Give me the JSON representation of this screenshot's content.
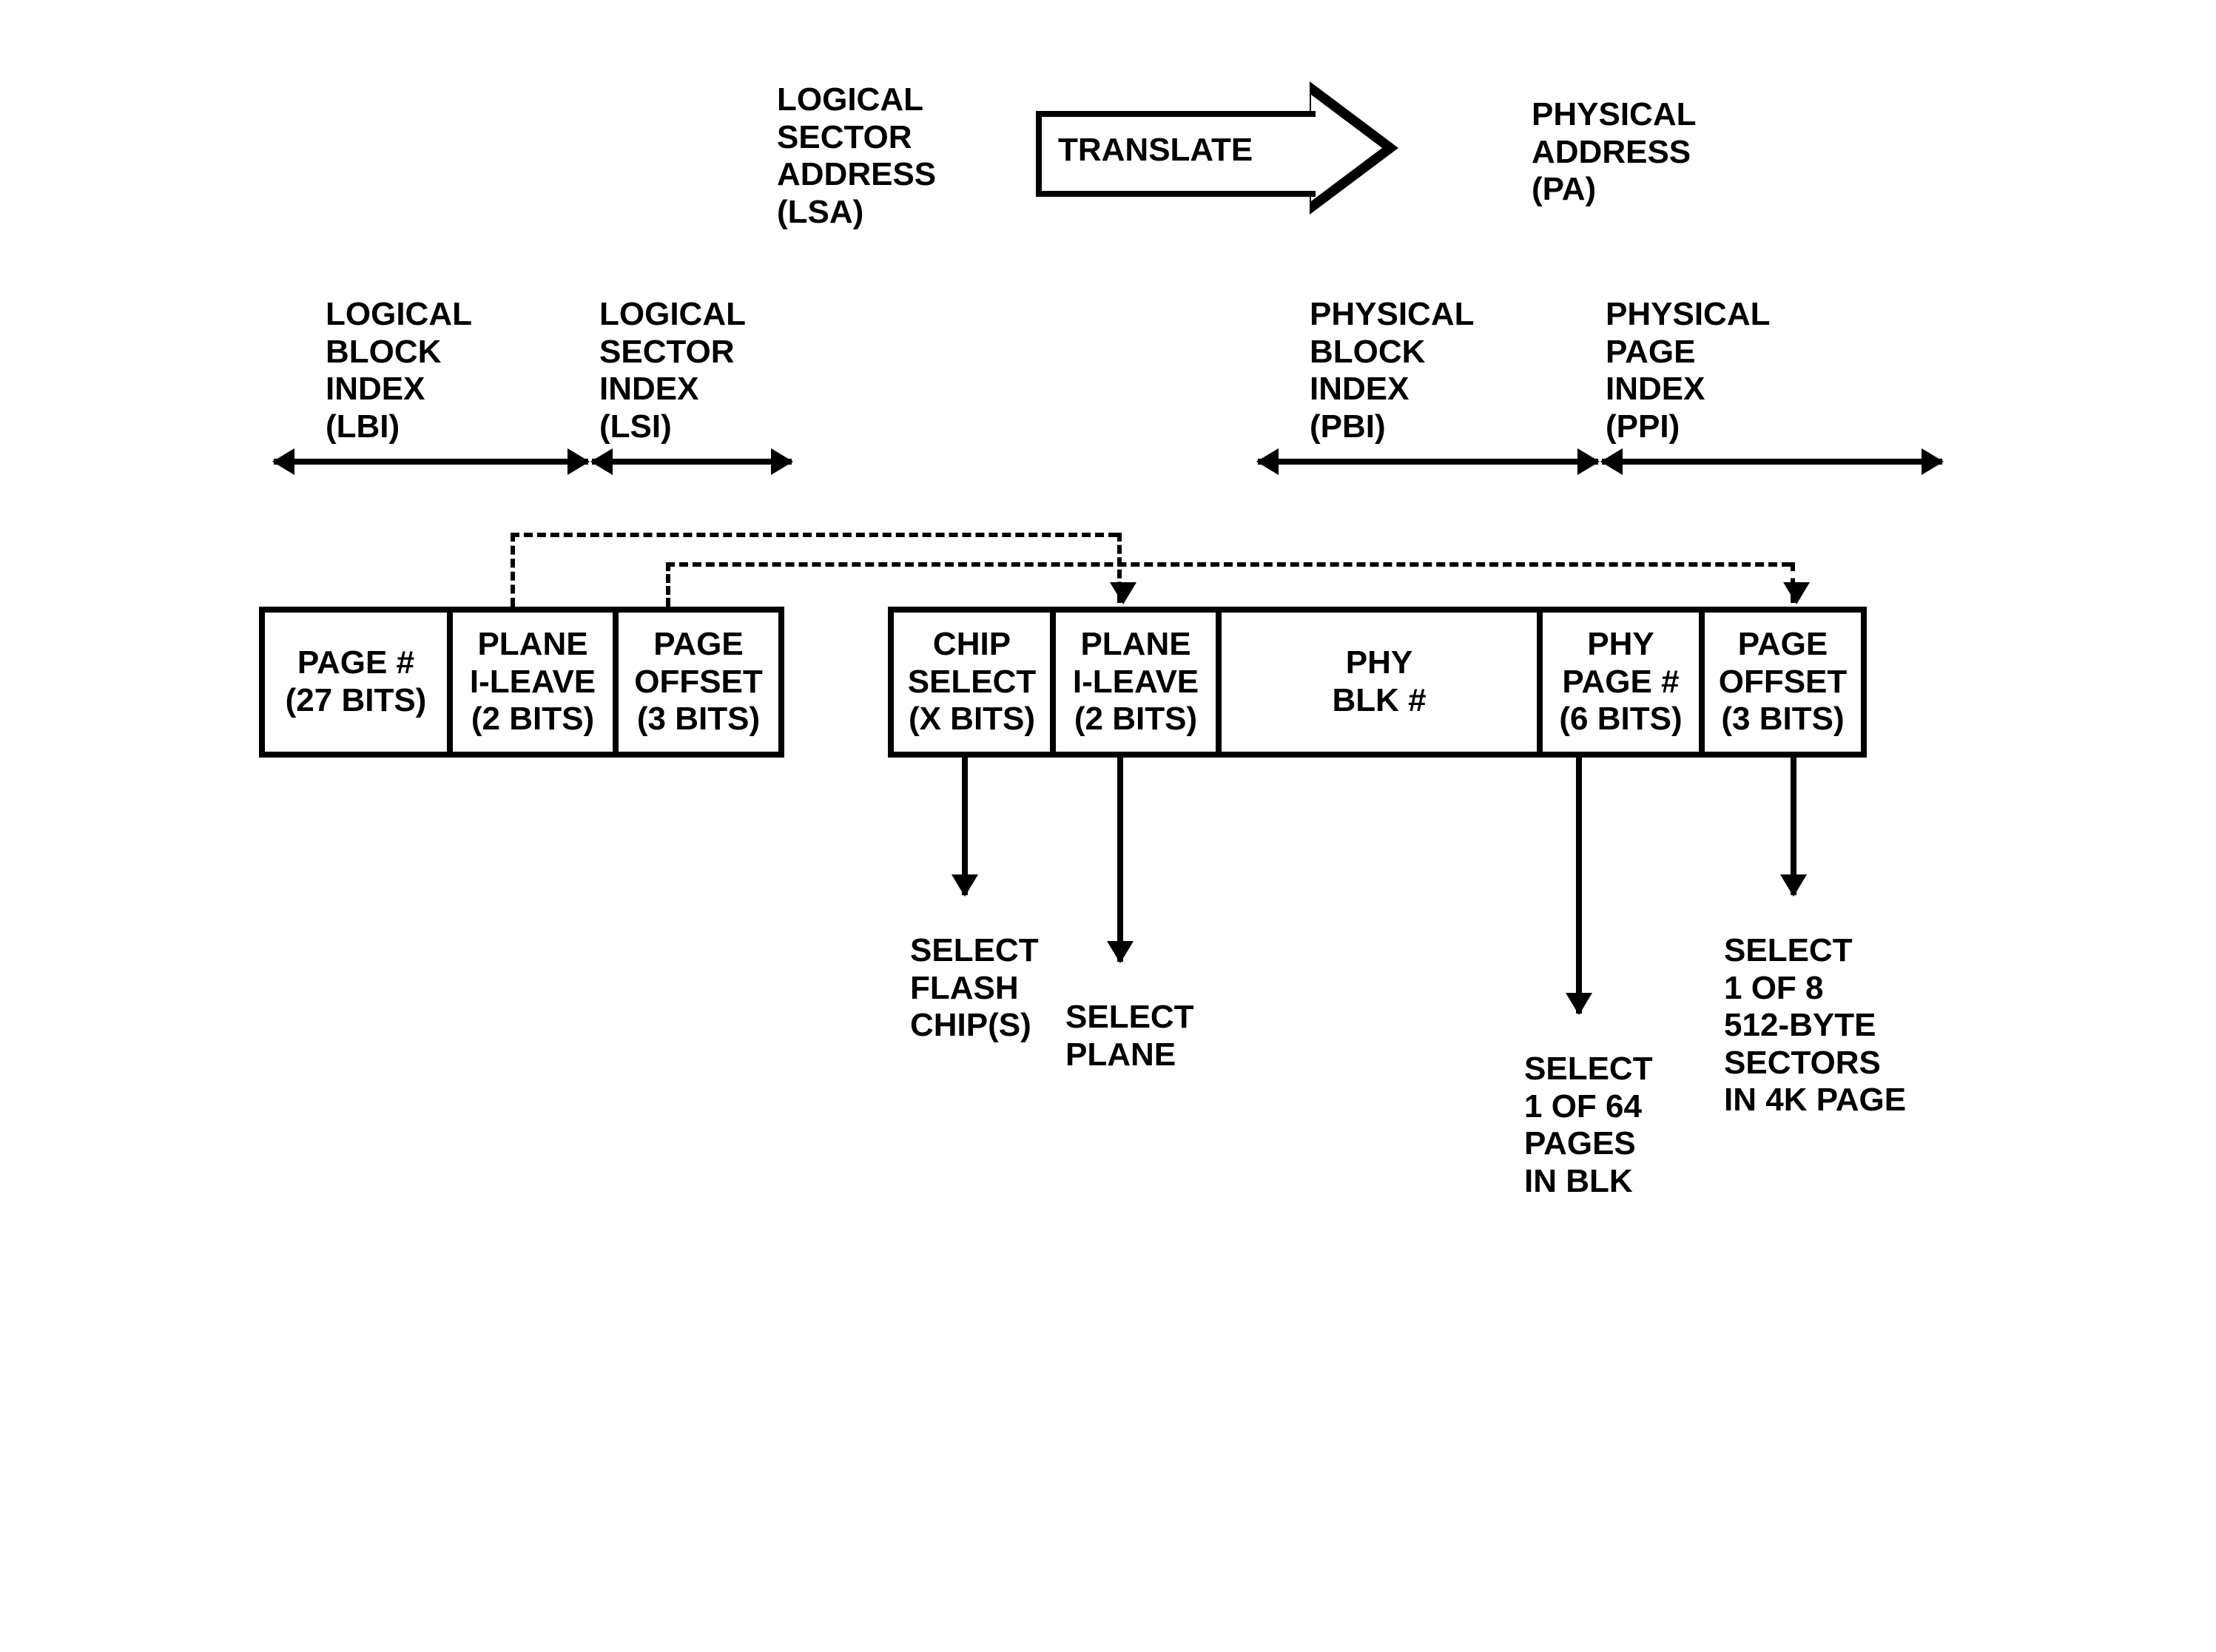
{
  "top": {
    "lsa": "LOGICAL\nSECTOR\nADDRESS\n(LSA)",
    "translate": "TRANSLATE",
    "pa": "PHYSICAL\nADDRESS\n(PA)"
  },
  "dims": {
    "lbi": "LOGICAL\nBLOCK\nINDEX\n(LBI)",
    "lsi": "LOGICAL\nSECTOR\nINDEX\n(LSI)",
    "pbi": "PHYSICAL\nBLOCK\nINDEX\n(PBI)",
    "ppi": "PHYSICAL\nPAGE\nINDEX\n(PPI)"
  },
  "left_fields": {
    "page_num": "PAGE #\n(27 BITS)",
    "plane": "PLANE\nI-LEAVE\n(2 BITS)",
    "offset": "PAGE\nOFFSET\n(3 BITS)"
  },
  "right_fields": {
    "chip": "CHIP\nSELECT\n(X BITS)",
    "plane": "PLANE\nI-LEAVE\n(2 BITS)",
    "blk": "PHY\nBLK #",
    "page": "PHY\nPAGE #\n(6 BITS)",
    "offset": "PAGE\nOFFSET\n(3 BITS)"
  },
  "annot": {
    "chip": "SELECT\nFLASH\nCHIP(S)",
    "plane": "SELECT\nPLANE",
    "page": "SELECT\n1 OF 64\nPAGES\nIN BLK",
    "offset": "SELECT\n1 OF 8\n512-BYTE\nSECTORS\nIN 4K PAGE"
  }
}
